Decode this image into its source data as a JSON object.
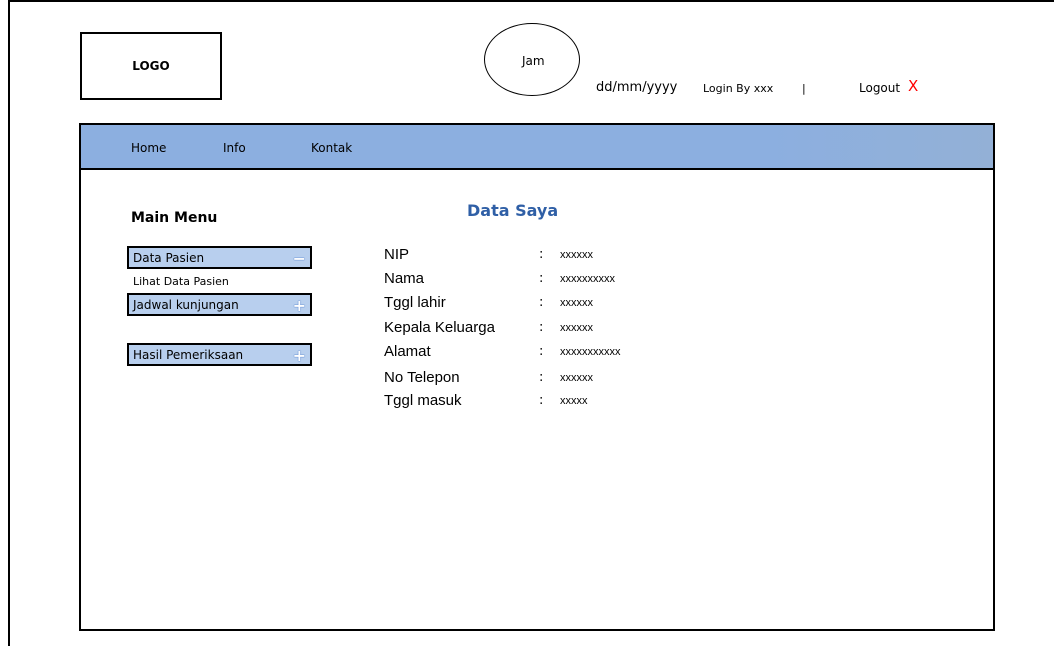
{
  "header": {
    "logo_text": "LOGO",
    "clock_label": "Jam",
    "date": "dd/mm/yyyy",
    "login_text": "Login By xxx",
    "separator": "|",
    "logout_label": "Logout",
    "logout_icon": "X"
  },
  "nav": {
    "items": [
      "Home",
      "Info",
      "Kontak"
    ]
  },
  "sidebar": {
    "title": "Main Menu",
    "items": [
      {
        "label": "Data Pasien",
        "icon": "minus-icon"
      },
      {
        "label": "Lihat Data Pasien"
      },
      {
        "label": "Jadwal kunjungan",
        "icon": "plus-icon"
      },
      {
        "label": "Hasil Pemeriksaan",
        "icon": "plus-icon"
      }
    ]
  },
  "content": {
    "title": "Data Saya",
    "fields": [
      {
        "label": "NIP",
        "value": "xxxxxx"
      },
      {
        "label": "Nama",
        "value": "xxxxxxxxxx"
      },
      {
        "label": "Tggl lahir",
        "value": "xxxxxx"
      },
      {
        "label": "Kepala Keluarga",
        "value": "xxxxxx"
      },
      {
        "label": "Alamat",
        "value": "xxxxxxxxxxx"
      },
      {
        "label": "No Telepon",
        "value": "xxxxxx"
      },
      {
        "label": "Tggl masuk",
        "value": "xxxxx"
      }
    ],
    "separator": ":"
  },
  "colors": {
    "nav_bg": "#8cafe0",
    "title": "#2f5fa6",
    "logout_x": "#ff0000"
  }
}
